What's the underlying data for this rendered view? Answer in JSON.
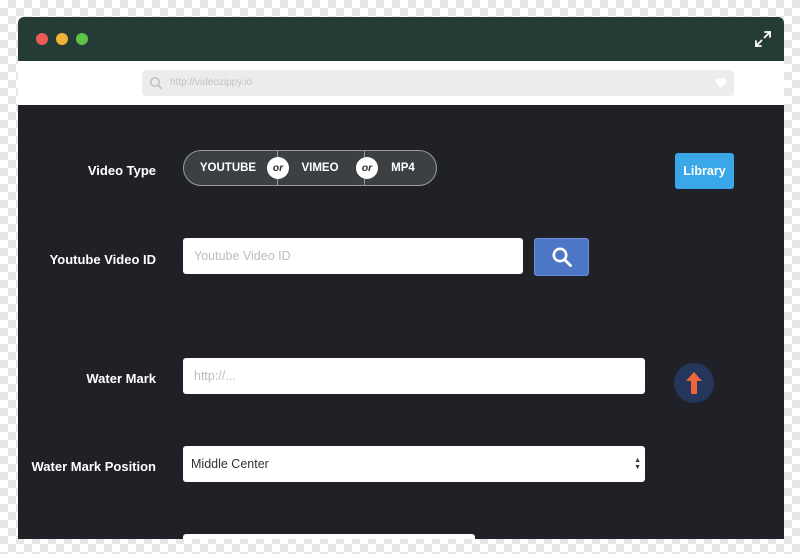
{
  "browser": {
    "url": "http://videozippy.io"
  },
  "form": {
    "video_type_label": "Video Type",
    "video_type_options": [
      "YOUTUBE",
      "VIMEO",
      "MP4"
    ],
    "or_label": "or",
    "library_button": "Library",
    "youtube_id_label": "Youtube Video ID",
    "youtube_id_placeholder": "Youtube Video ID",
    "watermark_label": "Water Mark",
    "watermark_placeholder": "http://...",
    "watermark_position_label": "Water Mark Position",
    "watermark_position_value": "Middle Center"
  },
  "colors": {
    "titlebar": "#243b36",
    "content_bg": "#1f2126",
    "library_button": "#3aa7e8",
    "search_button": "#4d76c7",
    "upload_arrow": "#f0643a"
  },
  "icons": {
    "expand": "expand-icon",
    "search": "search-icon",
    "upload": "upload-arrow-icon"
  }
}
